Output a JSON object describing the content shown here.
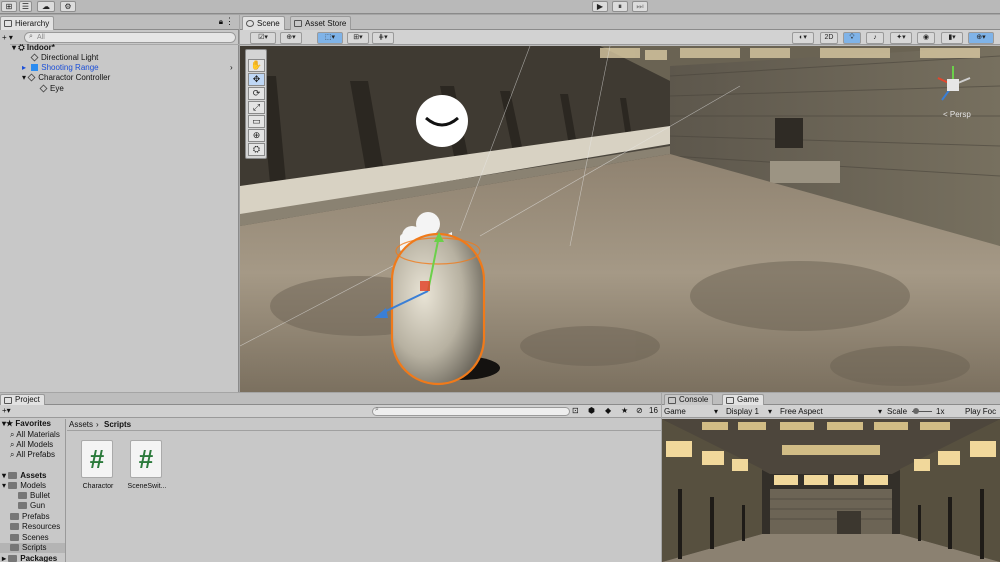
{
  "top": {
    "play": "▶",
    "pause": "⏸",
    "step": "⏭"
  },
  "hierarchy": {
    "tab": "Hierarchy",
    "search_placeholder": "All",
    "scene": "Indoor*",
    "items": [
      {
        "label": "Directional Light",
        "color": "#111111"
      },
      {
        "label": "Shooting Range",
        "color": "#1b4fd8"
      },
      {
        "label": "Charactor Controller",
        "color": "#111111"
      },
      {
        "label": "Eye",
        "color": "#111111"
      }
    ]
  },
  "scene": {
    "tabs": [
      "Scene",
      "Asset Store"
    ],
    "toggle_2d": "2D",
    "persp": "< Persp",
    "tools": [
      "✋",
      "✥",
      "⟳",
      "⤢",
      "▭",
      "⊕",
      "⛭"
    ]
  },
  "project": {
    "tab": "Project",
    "count": "16",
    "favorites_label": "Favorites",
    "favorites": [
      "All Materials",
      "All Models",
      "All Prefabs"
    ],
    "assets_label": "Assets",
    "tree": [
      {
        "label": "Models",
        "level": 1
      },
      {
        "label": "Bullet",
        "level": 2
      },
      {
        "label": "Gun",
        "level": 2
      },
      {
        "label": "Prefabs",
        "level": 1
      },
      {
        "label": "Resources",
        "level": 1
      },
      {
        "label": "Scenes",
        "level": 1
      },
      {
        "label": "Scripts",
        "level": 1
      }
    ],
    "packages_label": "Packages",
    "breadcrumb": [
      "Assets",
      "Scripts"
    ],
    "files": [
      {
        "name": "Charactor",
        "glyph": "#"
      },
      {
        "name": "SceneSwit...",
        "glyph": "#"
      }
    ]
  },
  "game": {
    "tabs": [
      "Console",
      "Game"
    ],
    "display_mode": "Game",
    "display": "Display 1",
    "aspect": "Free Aspect",
    "scale_label": "Scale",
    "scale_value": "1x",
    "play_focused": "Play Foc"
  },
  "colors": {
    "accent": "#3a7fd6",
    "selection": "#7aa6d8",
    "capsule_outline": "#f07a1a"
  }
}
